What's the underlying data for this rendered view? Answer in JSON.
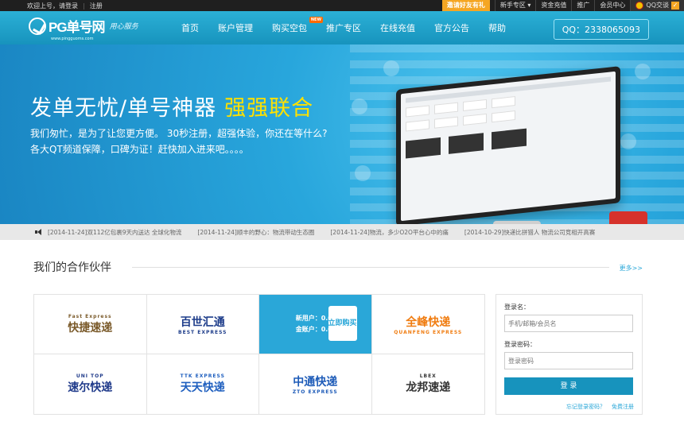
{
  "topbar": {
    "welcome": "欢迎上号，请登录",
    "register": "注册",
    "invite": "邀请好友有礼",
    "items": [
      "新手专区",
      "资金充值",
      "推广",
      "会员中心"
    ],
    "qq": "QQ交谈"
  },
  "header": {
    "logo_text": "PG单号网",
    "logo_sub": "www.pingguoms.com",
    "logo_slogan": "用心服务",
    "nav": [
      {
        "label": "首页"
      },
      {
        "label": "账户管理"
      },
      {
        "label": "购买空包",
        "badge": "NEW"
      },
      {
        "label": "推广专区"
      },
      {
        "label": "在线充值"
      },
      {
        "label": "官方公告"
      },
      {
        "label": "帮助"
      }
    ],
    "qq_contact": "QQ：2338065093"
  },
  "banner": {
    "title_main": "发单无忧/单号神器",
    "title_highlight": "强强联合",
    "desc_line1": "我们匆忙，是为了让您更方便。 30秒注册，超强体验，你还在等什么?",
    "desc_line2": "各大QT频道保障，口碑为证！赶快加入进来吧。。。。",
    "slides": 4,
    "active_slide": 1
  },
  "news": [
    "[2014-11-24]双112亿包裹9天内送达 全球化物流",
    "[2014-11-24]顺丰的野心：物流带动生态圈",
    "[2014-11-24]物流，多少O2O平台心中的痛",
    "[2014-10-29]快递比拼猎人 物流公司竞相开高赛"
  ],
  "partners": {
    "title": "我们的合作伙伴",
    "more": "更多>>",
    "logos": [
      {
        "cn": "快捷速递",
        "en": "Fast Express",
        "color": "#7a5a2a"
      },
      {
        "cn": "百世汇通",
        "en": "BEST EXPRESS",
        "color": "#1d3c8a"
      },
      {
        "promo": true
      },
      {
        "cn": "全峰快递",
        "en": "QUANFENG EXPRESS",
        "color": "#f07c10"
      },
      {
        "cn": "速尔快递",
        "en": "UNI TOP",
        "color": "#1f3a8a"
      },
      {
        "cn": "天天快递",
        "en": "TTK EXPRESS",
        "color": "#1f5fbf"
      },
      {
        "cn": "中通快递",
        "en": "ZTO EXPRESS",
        "color": "#1d5bb8"
      },
      {
        "cn": "龙邦速递",
        "en": "LBEX",
        "color": "#333"
      }
    ],
    "promo": {
      "line1": "新用户：0.0元/单",
      "line2": "金账户：0.0元/单",
      "button": "立即购买"
    }
  },
  "login": {
    "username_label": "登录名：",
    "username_placeholder": "手机/邮箱/会员名",
    "password_label": "登录密码：",
    "password_placeholder": "登录密码",
    "submit": "登 录",
    "forgot": "忘记登录密码？",
    "register": "免费注册"
  }
}
